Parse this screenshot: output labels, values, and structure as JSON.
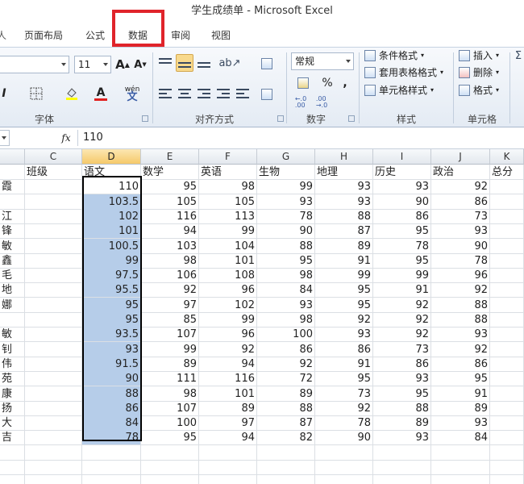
{
  "window": {
    "title": "学生成绩单  -  Microsoft Excel"
  },
  "tabs": [
    {
      "label": "页面布局"
    },
    {
      "label": "公式"
    },
    {
      "label": "数据",
      "highlighted": true
    },
    {
      "label": "审阅"
    },
    {
      "label": "视图"
    }
  ],
  "tab_partial_left": "人",
  "ribbon": {
    "font": {
      "size": "11",
      "grow_label": "A",
      "shrink_label": "A",
      "font_color_label": "A",
      "phonetic_label": "wén",
      "group_label": "字体"
    },
    "alignment": {
      "group_label": "对齐方式"
    },
    "number": {
      "format": "常规",
      "percent_label": "%",
      "comma_label": ",",
      "inc_decimal_label": "←.0\n.00",
      "dec_decimal_label": ".00\n→.0",
      "group_label": "数字"
    },
    "styles": {
      "conditional_label": "条件格式",
      "table_label": "套用表格格式",
      "cell_styles_label": "单元格样式",
      "group_label": "样式"
    },
    "cells": {
      "insert_label": "插入",
      "delete_label": "删除",
      "format_label": "格式",
      "group_label": "单元格"
    }
  },
  "formula_bar": {
    "fx_label": "fx",
    "value": "110"
  },
  "columns": [
    "C",
    "D",
    "E",
    "F",
    "G",
    "H",
    "I",
    "J",
    "K"
  ],
  "selected_column": "D",
  "header_row": [
    "班级",
    "语文",
    "数学",
    "英语",
    "生物",
    "地理",
    "历史",
    "政治",
    "总分"
  ],
  "row_stubs": [
    "霞",
    "",
    "江",
    "锋",
    "敏",
    "鑫",
    "毛",
    "地",
    "娜",
    "",
    "敏",
    "钊",
    "伟",
    "苑",
    "康",
    "扬",
    "大",
    "吉"
  ],
  "rows": [
    [
      "",
      "110",
      "95",
      "98",
      "99",
      "93",
      "93",
      "92",
      ""
    ],
    [
      "",
      "103.5",
      "105",
      "105",
      "93",
      "93",
      "90",
      "86",
      ""
    ],
    [
      "",
      "102",
      "116",
      "113",
      "78",
      "88",
      "86",
      "73",
      ""
    ],
    [
      "",
      "101",
      "94",
      "99",
      "90",
      "87",
      "95",
      "93",
      ""
    ],
    [
      "",
      "100.5",
      "103",
      "104",
      "88",
      "89",
      "78",
      "90",
      ""
    ],
    [
      "",
      "99",
      "98",
      "101",
      "95",
      "91",
      "95",
      "78",
      ""
    ],
    [
      "",
      "97.5",
      "106",
      "108",
      "98",
      "99",
      "99",
      "96",
      ""
    ],
    [
      "",
      "95.5",
      "92",
      "96",
      "84",
      "95",
      "91",
      "92",
      ""
    ],
    [
      "",
      "95",
      "97",
      "102",
      "93",
      "95",
      "92",
      "88",
      ""
    ],
    [
      "",
      "95",
      "85",
      "99",
      "98",
      "92",
      "92",
      "88",
      ""
    ],
    [
      "",
      "93.5",
      "107",
      "96",
      "100",
      "93",
      "92",
      "93",
      ""
    ],
    [
      "",
      "93",
      "99",
      "92",
      "86",
      "86",
      "73",
      "92",
      ""
    ],
    [
      "",
      "91.5",
      "89",
      "94",
      "92",
      "91",
      "86",
      "86",
      ""
    ],
    [
      "",
      "90",
      "111",
      "116",
      "72",
      "95",
      "93",
      "95",
      ""
    ],
    [
      "",
      "88",
      "98",
      "101",
      "89",
      "73",
      "95",
      "91",
      ""
    ],
    [
      "",
      "86",
      "107",
      "89",
      "88",
      "92",
      "88",
      "89",
      ""
    ],
    [
      "",
      "84",
      "100",
      "97",
      "87",
      "78",
      "89",
      "93",
      ""
    ],
    [
      "",
      "78",
      "95",
      "94",
      "82",
      "90",
      "93",
      "84",
      ""
    ]
  ],
  "colors": {
    "highlight_box": "#e0242b",
    "selection_fill": "#b6cde9",
    "selected_header": "#f5c96a"
  }
}
